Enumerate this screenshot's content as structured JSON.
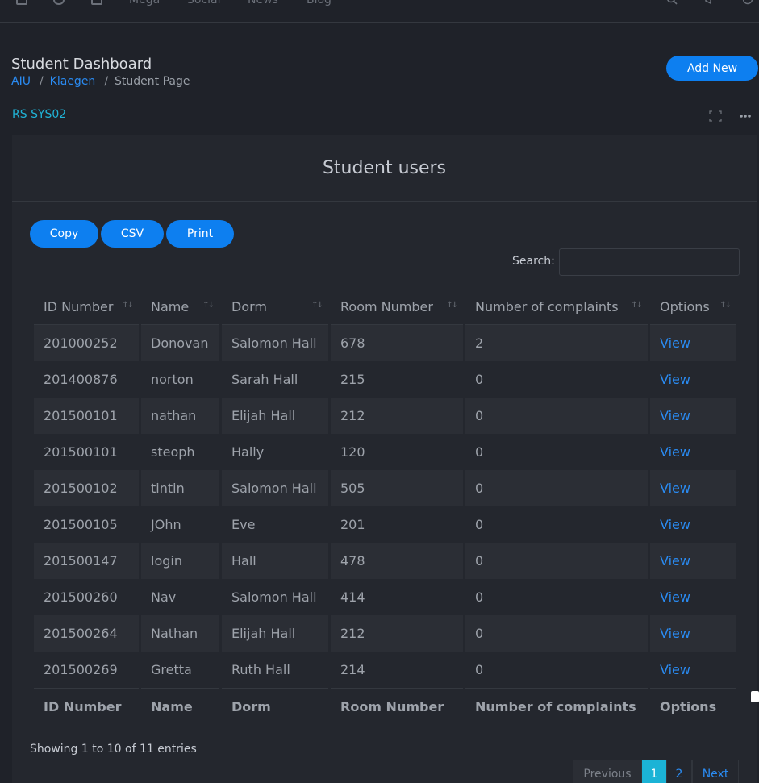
{
  "nav": {
    "items": [
      "Mega",
      "Social",
      "News",
      "Blog"
    ]
  },
  "header": {
    "title": "Student Dashboard",
    "breadcrumb": [
      "AIU",
      "Klaegen",
      "Student Page"
    ],
    "add_new_label": "Add New"
  },
  "card": {
    "label": "RS SYS02",
    "title": "Student users"
  },
  "toolbar": {
    "buttons": [
      "Copy",
      "CSV",
      "Print"
    ],
    "search_label": "Search:",
    "search_value": ""
  },
  "table": {
    "columns": [
      "ID Number",
      "Name",
      "Dorm",
      "Room Number",
      "Number of complaints",
      "Options"
    ],
    "rows": [
      [
        "201000252",
        "Donovan",
        "Salomon Hall",
        "678",
        "2",
        "View"
      ],
      [
        "201400876",
        "norton",
        "Sarah Hall",
        "215",
        "0",
        "View"
      ],
      [
        "201500101",
        "nathan",
        "Elijah Hall",
        "212",
        "0",
        "View"
      ],
      [
        "201500101",
        "steoph",
        "Hally",
        "120",
        "0",
        "View"
      ],
      [
        "201500102",
        "tintin",
        "Salomon Hall",
        "505",
        "0",
        "View"
      ],
      [
        "201500105",
        "JOhn",
        "Eve",
        "201",
        "0",
        "View"
      ],
      [
        "201500147",
        "login",
        "Hall",
        "478",
        "0",
        "View"
      ],
      [
        "201500260",
        "Nav",
        "Salomon Hall",
        "414",
        "0",
        "View"
      ],
      [
        "201500264",
        "Nathan",
        "Elijah Hall",
        "212",
        "0",
        "View"
      ],
      [
        "201500269",
        "Gretta",
        "Ruth Hall",
        "214",
        "0",
        "View"
      ]
    ]
  },
  "info": "Showing 1 to 10 of 11 entries",
  "pagination": {
    "previous": "Previous",
    "pages": [
      "1",
      "2"
    ],
    "next": "Next",
    "current": "1"
  },
  "colors": {
    "accent": "#0d7ff0",
    "link": "#2a8bf2",
    "cyan": "#1bb3d6",
    "background": "#1f2229",
    "card": "#24272e"
  }
}
